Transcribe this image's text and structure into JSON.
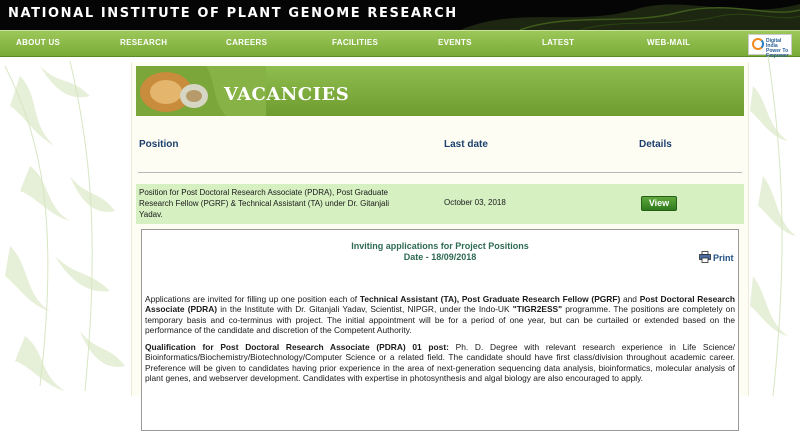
{
  "header": {
    "title": "NATIONAL INSTITUTE OF PLANT GENOME RESEARCH"
  },
  "nav": {
    "items": [
      "ABOUT US",
      "RESEARCH",
      "CAREERS",
      "FACILITIES",
      "EVENTS",
      "LATEST",
      "WEB-MAIL"
    ],
    "logo_text": [
      "Digital India",
      "Power To Empower"
    ]
  },
  "banner": {
    "title": "VACANCIES"
  },
  "table": {
    "headers": {
      "position": "Position",
      "last_date": "Last date",
      "details": "Details"
    },
    "rows": [
      {
        "position": "Position for Post Doctoral Research Associate (PDRA), Post Graduate Research Fellow (PGRF) & Technical Assistant (TA) under Dr. Gitanjali Yadav.",
        "last_date": "October 03, 2018",
        "action": "View"
      }
    ]
  },
  "detail": {
    "heading": "Inviting applications for Project Positions",
    "date_line": "Date - 18/09/2018",
    "print_label": "Print",
    "para1": {
      "t1": "Applications are invited for filling up one position each of ",
      "b1": "Technical Assistant (TA), Post Graduate Research Fellow (PGRF)",
      "t2": " and ",
      "b2": "Post Doctoral Research Associate (PDRA)",
      "t3": " in the Institute with Dr. Gitanjali Yadav, Scientist, NIPGR, under the Indo-UK ",
      "b3": "\"TIGR2ESS\"",
      "t4": " programme. The positions are completely on temporary basis and co-terminus with project. The initial appointment will be for a period of one year, but can be curtailed or extended based on the performance of the candidate and discretion of the Competent Authority."
    },
    "para2": {
      "b1": "Qualification for Post Doctoral Research Associate (PDRA) 01 post:",
      "t1": " Ph. D. Degree with relevant research experience in Life Science/ Bioinformatics/Biochemistry/Biotechnology/Computer Science or a related field. The candidate should have first class/division throughout academic career. Preference will be given to candidates having prior experience in the area of next-generation sequencing data analysis, bioinformatics, molecular analysis of plant genes, and webserver development. Candidates with expertise in photosynthesis and algal biology are also encouraged to apply."
    }
  },
  "colors": {
    "nav_green": "#8cbb47",
    "header_blue": "#1c3f6e",
    "row_green": "#d6f0c2",
    "detail_heading": "#2e6a52"
  }
}
